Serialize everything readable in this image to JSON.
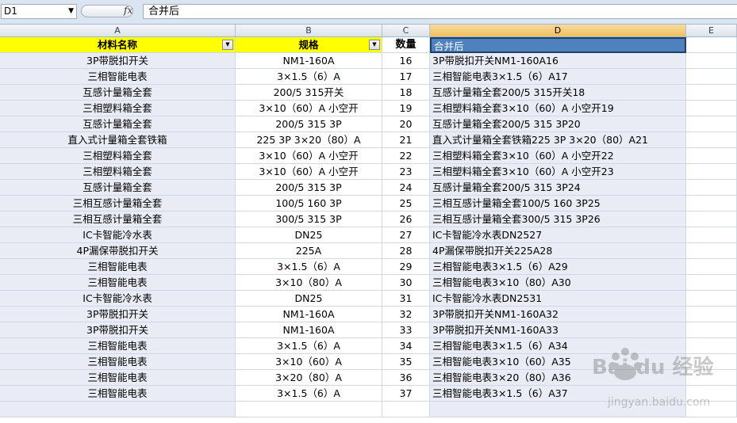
{
  "formula_bar": {
    "name_box": "D1",
    "fx_label": "fx",
    "content": "合并后"
  },
  "columns": [
    "A",
    "B",
    "C",
    "D",
    "E"
  ],
  "header": {
    "a": "材料名称",
    "b": "规格",
    "c": "数量",
    "d": "合并后"
  },
  "rows": [
    {
      "a": "3P带脱扣开关",
      "b": "NM1-160A",
      "c": "16",
      "d": "3P带脱扣开关NM1-160A16"
    },
    {
      "a": "三相智能电表",
      "b": "3×1.5（6）A",
      "c": "17",
      "d": "三相智能电表3×1.5（6）A17"
    },
    {
      "a": "互感计量箱全套",
      "b": "200/5 315开关",
      "c": "18",
      "d": "互感计量箱全套200/5 315开关18"
    },
    {
      "a": "三相塑料箱全套",
      "b": "3×10（60）A 小空开",
      "c": "19",
      "d": "三相塑料箱全套3×10（60）A 小空开19"
    },
    {
      "a": "互感计量箱全套",
      "b": "200/5 315 3P",
      "c": "20",
      "d": "互感计量箱全套200/5 315 3P20"
    },
    {
      "a": "直入式计量箱全套铁箱",
      "b": "225 3P 3×20（80）A",
      "c": "21",
      "d": "直入式计量箱全套铁箱225 3P 3×20（80）A21"
    },
    {
      "a": "三相塑料箱全套",
      "b": "3×10（60）A 小空开",
      "c": "22",
      "d": "三相塑料箱全套3×10（60）A 小空开22"
    },
    {
      "a": "三相塑料箱全套",
      "b": "3×10（60）A 小空开",
      "c": "23",
      "d": "三相塑料箱全套3×10（60）A 小空开23"
    },
    {
      "a": "互感计量箱全套",
      "b": "200/5 315 3P",
      "c": "24",
      "d": "互感计量箱全套200/5 315 3P24"
    },
    {
      "a": "三相互感计量箱全套",
      "b": "100/5 160 3P",
      "c": "25",
      "d": "三相互感计量箱全套100/5 160 3P25"
    },
    {
      "a": "三相互感计量箱全套",
      "b": "300/5 315 3P",
      "c": "26",
      "d": "三相互感计量箱全套300/5 315 3P26"
    },
    {
      "a": "IC卡智能冷水表",
      "b": "DN25",
      "c": "27",
      "d": "IC卡智能冷水表DN2527"
    },
    {
      "a": "4P漏保带脱扣开关",
      "b": "225A",
      "c": "28",
      "d": "4P漏保带脱扣开关225A28"
    },
    {
      "a": "三相智能电表",
      "b": "3×1.5（6）A",
      "c": "29",
      "d": "三相智能电表3×1.5（6）A29"
    },
    {
      "a": "三相智能电表",
      "b": "3×10（80）A",
      "c": "30",
      "d": "三相智能电表3×10（80）A30"
    },
    {
      "a": "IC卡智能冷水表",
      "b": "DN25",
      "c": "31",
      "d": "IC卡智能冷水表DN2531"
    },
    {
      "a": "3P带脱扣开关",
      "b": "NM1-160A",
      "c": "32",
      "d": "3P带脱扣开关NM1-160A32"
    },
    {
      "a": "3P带脱扣开关",
      "b": "NM1-160A",
      "c": "33",
      "d": "3P带脱扣开关NM1-160A33"
    },
    {
      "a": "三相智能电表",
      "b": "3×1.5（6）A",
      "c": "34",
      "d": "三相智能电表3×1.5（6）A34"
    },
    {
      "a": "三相智能电表",
      "b": "3×10（60）A",
      "c": "35",
      "d": "三相智能电表3×10（60）A35"
    },
    {
      "a": "三相智能电表",
      "b": "3×20（80）A",
      "c": "36",
      "d": "三相智能电表3×20（80）A36"
    },
    {
      "a": "三相智能电表",
      "b": "3×1.5（6）A",
      "c": "37",
      "d": "三相智能电表3×1.5（6）A37"
    },
    {
      "a": "",
      "b": "",
      "c": "",
      "d": ""
    }
  ],
  "watermark": {
    "brand": "Bai du 经验",
    "url": "jingyan.baidu.com"
  },
  "colors": {
    "header_yellow": "#ffff00",
    "selected_blue": "#4f81bd",
    "column_shade": "#e9ecf5"
  }
}
